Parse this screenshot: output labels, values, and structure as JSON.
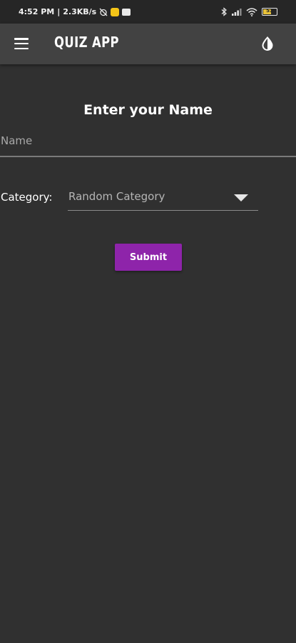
{
  "status_bar": {
    "time": "4:52 PM",
    "speed": "2.3KB/s",
    "battery": "53",
    "colors": {
      "notification_badge": "#f5c518",
      "battery_fill": "#e8c23a"
    }
  },
  "app_bar": {
    "title": "QUIZ APP",
    "menu_icon": "hamburger-menu-icon",
    "theme_icon": "contrast-drop-icon",
    "background": "#424242"
  },
  "form": {
    "heading": "Enter your Name",
    "name_field": {
      "placeholder": "Name",
      "value": ""
    },
    "category": {
      "label": "Category:",
      "selected": "Random Category"
    },
    "submit_label": "Submit",
    "accent_color": "#8e24aa"
  }
}
